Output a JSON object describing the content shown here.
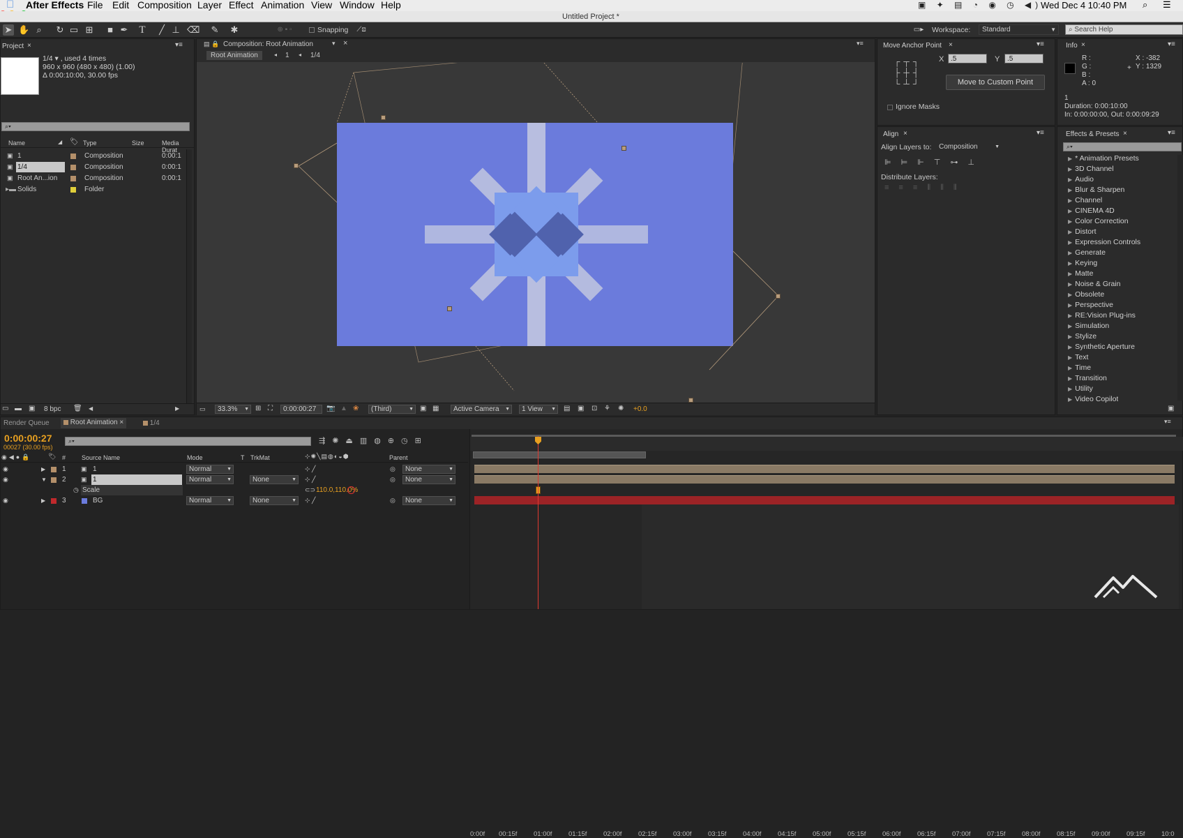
{
  "menubar": {
    "app": "After Effects",
    "items": [
      "File",
      "Edit",
      "Composition",
      "Layer",
      "Effect",
      "Animation",
      "View",
      "Window",
      "Help"
    ],
    "datetime": "Wed Dec 4  10:40 PM"
  },
  "window": {
    "title": "Untitled Project *"
  },
  "toolbar": {
    "snapping": "Snapping",
    "workspace_label": "Workspace:",
    "workspace_value": "Standard",
    "search_placeholder": "Search Help"
  },
  "project": {
    "tab": "Project",
    "item_name": "1/4 ▾ , used 4 times",
    "dims": "960 x 960  (480 x 480) (1.00)",
    "duration": "Δ 0:00:10:00, 30.00 fps",
    "columns": [
      "Name",
      "Type",
      "Size",
      "Media Durat"
    ],
    "items": [
      {
        "name": "1",
        "type": "Composition",
        "dur": "0:00:1",
        "color": "#b4906a"
      },
      {
        "name": "1/4",
        "type": "Composition",
        "dur": "0:00:1",
        "color": "#b4906a"
      },
      {
        "name": "Root An...ion",
        "type": "Composition",
        "dur": "0:00:1",
        "color": "#b4906a"
      },
      {
        "name": "Solids",
        "type": "Folder",
        "dur": "",
        "color": "#e0cf3a"
      }
    ],
    "bpc": "8 bpc"
  },
  "comp": {
    "tab": "Composition: Root Animation",
    "breadcrumbs": [
      "Root Animation",
      "1",
      "1/4"
    ],
    "zoom": "33.3%",
    "time": "0:00:00:27",
    "resolution": "(Third)",
    "camera": "Active Camera",
    "views": "1 View",
    "exposure": "+0.0"
  },
  "anchor": {
    "tab": "Move Anchor Point",
    "x_label": "X",
    "x": ".5",
    "y_label": "Y",
    "y": ".5",
    "button": "Move to Custom Point",
    "ignore_masks": "Ignore Masks"
  },
  "info": {
    "tab": "Info",
    "r": "R :",
    "g": "G :",
    "b": "B :",
    "a": "A : 0",
    "x": "X : -382",
    "y": "Y : 1329",
    "line1": "1",
    "line2": "Duration: 0:00:10:00",
    "line3": "In: 0:00:00:00, Out: 0:00:09:29"
  },
  "align": {
    "tab": "Align",
    "align_to_label": "Align Layers to:",
    "align_to_value": "Composition",
    "distribute": "Distribute Layers:"
  },
  "effects": {
    "tab": "Effects & Presets",
    "items": [
      "* Animation Presets",
      "3D Channel",
      "Audio",
      "Blur & Sharpen",
      "Channel",
      "CINEMA 4D",
      "Color Correction",
      "Distort",
      "Expression Controls",
      "Generate",
      "Keying",
      "Matte",
      "Noise & Grain",
      "Obsolete",
      "Perspective",
      "RE:Vision Plug-ins",
      "Simulation",
      "Stylize",
      "Synthetic Aperture",
      "Text",
      "Time",
      "Transition",
      "Utility",
      "Video Copilot"
    ]
  },
  "timeline": {
    "tabs": [
      "Render Queue",
      "Root Animation",
      "1/4"
    ],
    "timecode": "0:00:00:27",
    "frames": "00027 (30.00 fps)",
    "columns": [
      "Source Name",
      "Mode",
      "T",
      "TrkMat",
      "Parent"
    ],
    "layers": [
      {
        "num": "1",
        "name": "1",
        "mode": "Normal",
        "trkmat": "",
        "parent": "None",
        "color": "#b4906a"
      },
      {
        "num": "2",
        "name": "1",
        "mode": "Normal",
        "trkmat": "None",
        "parent": "None",
        "color": "#b4906a"
      },
      {
        "num": "3",
        "name": "BG",
        "mode": "Normal",
        "trkmat": "None",
        "parent": "None",
        "color": "#c0292c"
      }
    ],
    "scale_label": "Scale",
    "scale_value": "110.0,110.0%",
    "ruler": [
      "0:00f",
      "00:15f",
      "01:00f",
      "01:15f",
      "02:00f",
      "02:15f",
      "03:00f",
      "03:15f",
      "04:00f",
      "04:15f",
      "05:00f",
      "05:15f",
      "06:00f",
      "06:15f",
      "07:00f",
      "07:15f",
      "08:00f",
      "08:15f",
      "09:00f",
      "09:15f",
      "10:0"
    ]
  },
  "colors": {
    "comp_bg": "#6b7bdc",
    "bg_red": "#9c2326",
    "layer_tan": "#8a7a65",
    "accent": "#e8a020"
  }
}
